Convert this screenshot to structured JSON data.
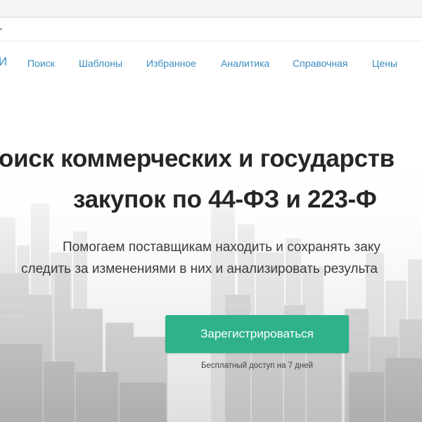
{
  "nav": {
    "logo_fragment": "И",
    "items": [
      {
        "label": "Поиск"
      },
      {
        "label": "Шаблоны"
      },
      {
        "label": "Избранное"
      },
      {
        "label": "Аналитика"
      },
      {
        "label": "Справочная"
      },
      {
        "label": "Цены"
      }
    ]
  },
  "hero": {
    "headline_line1": "оиск коммерческих и государств",
    "headline_line2": "закупок по 44-ФЗ и 223-Ф",
    "subtitle_line1": "Помогаем поставщикам находить и сохранять заку",
    "subtitle_line2": "следить за изменениями в них и анализировать результа",
    "cta_label": "Зарегистрироваться",
    "cta_note": "Бесплатный доступ на 7 дней"
  },
  "colors": {
    "accent_nav": "#3a8bbf",
    "cta_green": "#2fb28a",
    "headline": "#262626"
  }
}
